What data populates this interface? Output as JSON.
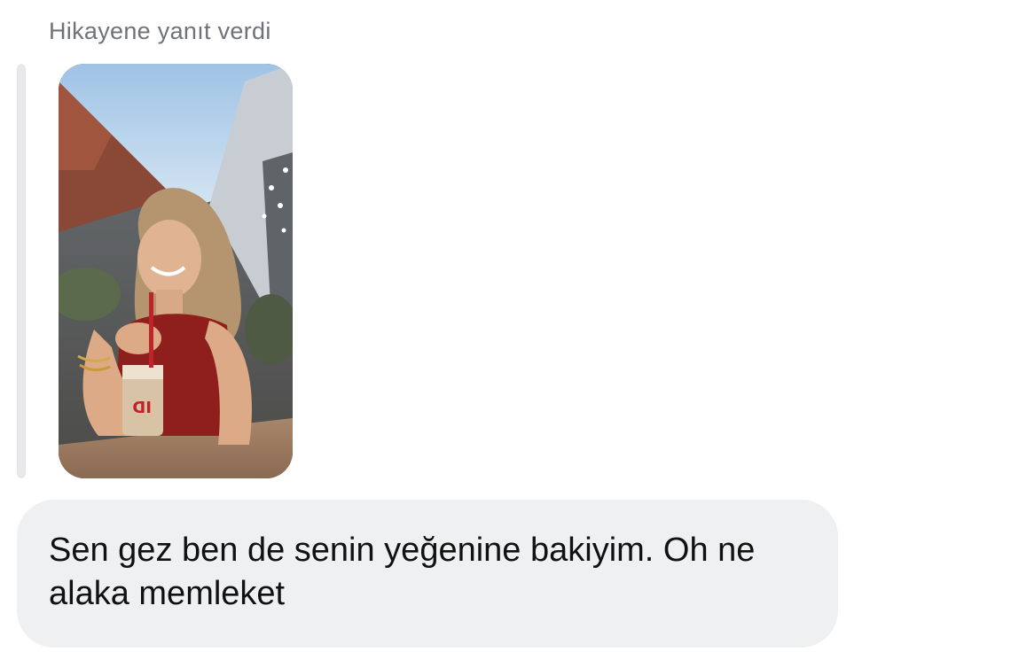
{
  "reply": {
    "label": "Hikayene yanıt verdi"
  },
  "story": {
    "thumbnail_icon": "story-photo",
    "description": "photo of a smiling woman in a red top holding an iced coffee cup"
  },
  "message": {
    "text": "Sen gez ben de senin yeğenine bakiyim. Oh ne alaka memleket"
  },
  "colors": {
    "label": "#6f7278",
    "bubble_bg": "#eff0f2",
    "quote_bar": "#e8e8ea",
    "text": "#111111"
  }
}
